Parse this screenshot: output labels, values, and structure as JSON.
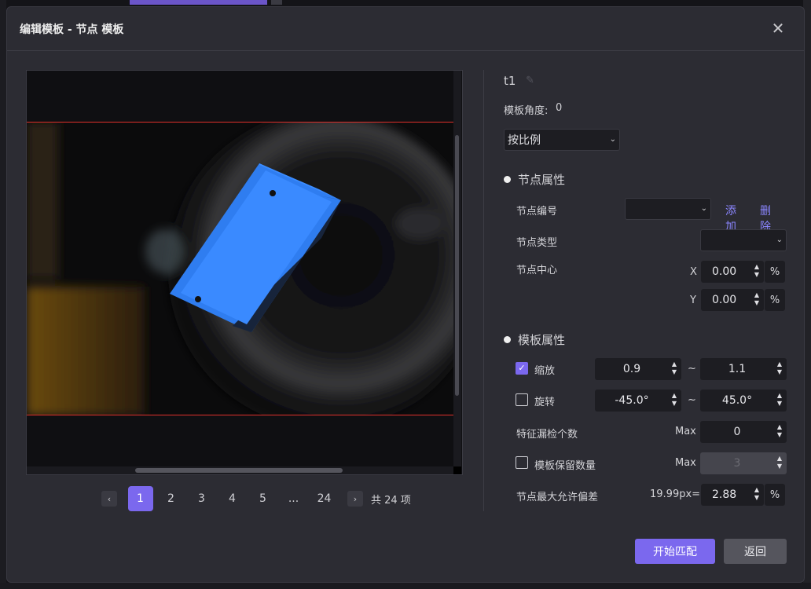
{
  "dialog": {
    "title": "编辑模板 - 节点 模板",
    "close_icon": "close-icon"
  },
  "pager": {
    "pages": [
      "1",
      "2",
      "3",
      "4",
      "5",
      "...",
      "24"
    ],
    "active": "1",
    "total_text": "共 24 项",
    "prev_icon": "chevron-left-icon",
    "next_icon": "chevron-right-icon"
  },
  "template": {
    "name": "t1",
    "edit_icon": "pencil-icon",
    "angle_label": "模板角度:",
    "angle_value": "0",
    "mode_select": "按比例"
  },
  "node_props": {
    "title": "节点属性",
    "id_label": "节点编号",
    "id_value": "",
    "add_label": "添加",
    "delete_label": "删除",
    "type_label": "节点类型",
    "type_value": "",
    "center_label": "节点中心",
    "x_label": "X",
    "x_value": "0.00",
    "y_label": "Y",
    "y_value": "0.00",
    "unit_percent": "%"
  },
  "template_props": {
    "title": "模板属性",
    "scale_label": "缩放",
    "scale_checked": true,
    "scale_min": "0.9",
    "scale_max": "1.1",
    "rotate_label": "旋转",
    "rotate_checked": false,
    "rotate_min": "-45.0°",
    "rotate_max": "45.0°",
    "tilde": "~",
    "missing_label": "特征漏检个数",
    "missing_max_label": "Max",
    "missing_value": "0",
    "keep_label": "模板保留数量",
    "keep_checked": false,
    "keep_max_label": "Max",
    "keep_value": "3",
    "deviation_label": "节点最大允许偏差",
    "deviation_px": "19.99px=",
    "deviation_value": "2.88",
    "deviation_unit": "%"
  },
  "actions": {
    "start_label": "开始匹配",
    "back_label": "返回"
  },
  "colors": {
    "accent": "#7b68ee",
    "panel": "#2c2c33",
    "input_bg": "#1d1d22",
    "roi_line": "#e0302b",
    "part_blue": "#2f7df0"
  }
}
